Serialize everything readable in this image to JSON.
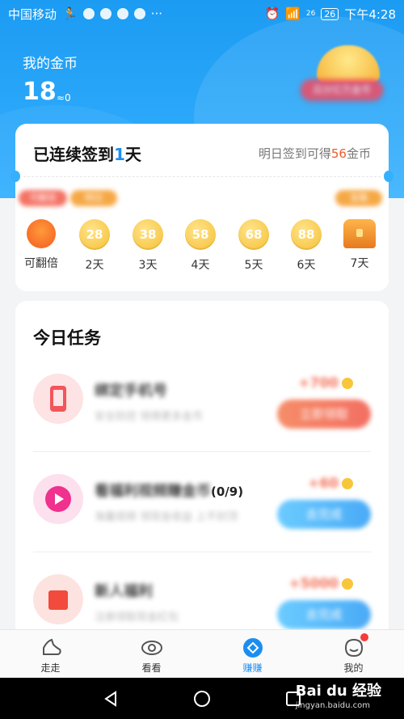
{
  "status_bar": {
    "carrier": "中国移动",
    "network": "26",
    "battery": "26",
    "time": "下午4:28"
  },
  "header": {
    "my_coins_label": "我的金币",
    "my_coins_value": "18",
    "approx_value": "≈0",
    "red_button_label": "瓜分亿万金币"
  },
  "checkin": {
    "title_prefix": "已连续签到",
    "title_days": "1",
    "title_suffix": "天",
    "tomorrow_prefix": "明日签到可得",
    "tomorrow_amount": "56",
    "tomorrow_suffix": "金币",
    "days": [
      {
        "label": "可翻倍",
        "coin": "",
        "kind": "double"
      },
      {
        "label": "2天",
        "coin": "28",
        "kind": "coin"
      },
      {
        "label": "3天",
        "coin": "38",
        "kind": "coin"
      },
      {
        "label": "4天",
        "coin": "58",
        "kind": "coin"
      },
      {
        "label": "5天",
        "coin": "68",
        "kind": "coin"
      },
      {
        "label": "6天",
        "coin": "88",
        "kind": "coin"
      },
      {
        "label": "7天",
        "coin": "",
        "kind": "chest"
      }
    ],
    "tips": [
      {
        "text": "可翻倍",
        "color": "#f35b4a"
      },
      {
        "text": "明日",
        "color": "#f59a26"
      },
      {
        "text": "宝箱",
        "color": "#f59a26"
      }
    ]
  },
  "tasks": {
    "title": "今日任务",
    "items": [
      {
        "name": "绑定手机号",
        "desc": "安全防控 领得更多金币",
        "reward": "+700",
        "button": "立即领取",
        "icon": "phone-icon",
        "icon_color": "#f2555b",
        "bg_color": "#fde3e3",
        "button_style": "orange"
      },
      {
        "name": "看福利视频赚金币",
        "suffix": "(0/9)",
        "desc": "海量视频 领现金收益 上不封顶",
        "reward": "+60",
        "button": "去完成",
        "icon": "play-icon",
        "icon_color": "#f0318e",
        "bg_color": "#fde0ee",
        "button_style": "blue"
      },
      {
        "name": "新人福利",
        "desc": "注册领取现金红包",
        "reward": "+5000",
        "button": "去完成",
        "icon": "gift-icon",
        "icon_color": "#f24a3c",
        "bg_color": "#fde3e0",
        "button_style": "blue"
      }
    ]
  },
  "tab_bar": {
    "tabs": [
      {
        "label": "走走",
        "icon": "shoe-icon"
      },
      {
        "label": "看看",
        "icon": "eye-icon"
      },
      {
        "label": "赚赚",
        "icon": "diamond-icon",
        "active": true
      },
      {
        "label": "我的",
        "icon": "profile-icon"
      }
    ]
  },
  "watermark": {
    "brand": "Bai du 经验",
    "site": "jingyan.baidu.com"
  },
  "colors": {
    "primary_blue": "#1a8ef0",
    "hero_blue": "#35b0ff",
    "accent_orange": "#f05a2a",
    "coin_yellow": "#f5c037"
  }
}
